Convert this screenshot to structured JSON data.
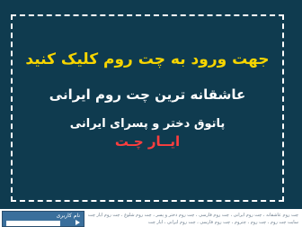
{
  "banner": {
    "line1": "جهت ورود به چت روم کلیک کنید",
    "line2": "عاشقانه ترین چت روم ایرانی",
    "line3": "پاتوق دختر و پسرای ایرانی",
    "line4": "ایــار چـت"
  },
  "login": {
    "label": "نام کاربری"
  },
  "footer": {
    "text_1": "چت روم عاشقانه ، چت روم ایرانی ، چت روم فارسی ، چت روم دختر و پسر ، چت روم شلوغ ، چت روم ایار چت",
    "text_2": "سایت چت روم ، چت روم ، چتروم ، چت روم فارسی ، چت روم ایرانی ، ایار چت"
  },
  "colors": {
    "banner_bg": "#0f3b4f",
    "headline": "#f7d500",
    "brand": "#ff3e3e"
  }
}
